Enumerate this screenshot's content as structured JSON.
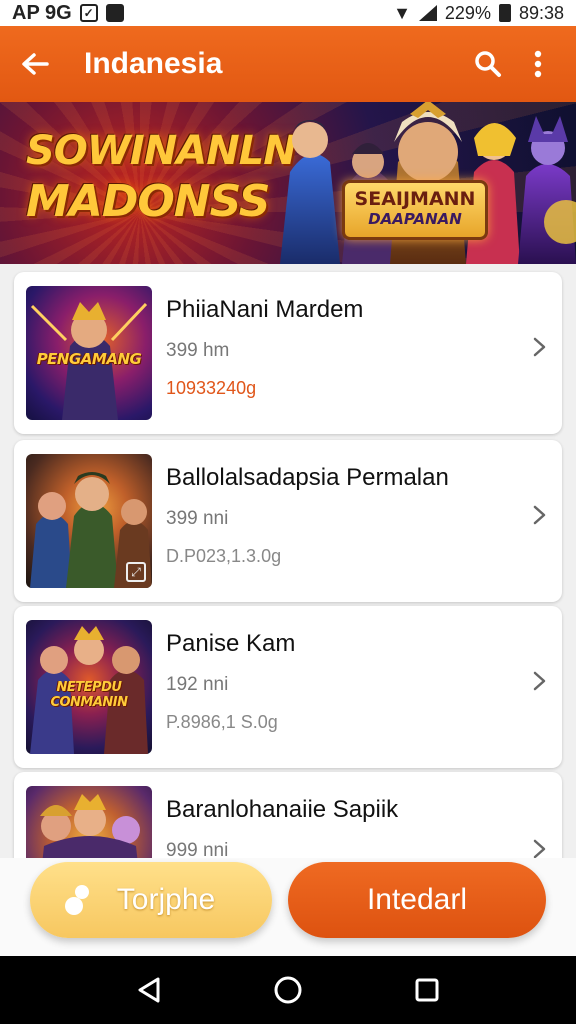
{
  "status_bar": {
    "left_text": "AP 9G",
    "battery": "229%",
    "time": "89:38"
  },
  "app_bar": {
    "title": "Indanesia",
    "back_icon": "arrow-left-icon",
    "search_icon": "search-icon",
    "menu_icon": "more-vert-icon"
  },
  "banner": {
    "logo_line_1": "SOWINANLN",
    "logo_line_2": "MADONSS",
    "sub_logo_line_1": "SEAIJMANN",
    "sub_logo_line_2": "DAAPANAN"
  },
  "items": [
    {
      "name": "PhiiaNani Mardem",
      "meta": "399 hm",
      "size": "10933240g",
      "thumb_label": "PENGAMANG"
    },
    {
      "name": "Ballolalsadapsia Permalan",
      "meta": "399 nni",
      "size": "D.P023,1.3.0g",
      "thumb_label": ""
    },
    {
      "name": "Panise Kam",
      "meta": "192 nni",
      "size": "P.8986,1 S.0g",
      "thumb_label": "NETEPDU CONMANIN"
    },
    {
      "name": "Baranlohanaiie Sapiik",
      "meta": "999 nni",
      "size": "",
      "thumb_label": ""
    }
  ],
  "actions": {
    "secondary_label": "Torjphe",
    "primary_label": "Intedarl"
  },
  "colors": {
    "accent": "#e85d17",
    "secondary_button": "#f7cf6e",
    "size_highlight": "#e0561a"
  },
  "nav": {
    "back_icon": "nav-back-icon",
    "home_icon": "nav-home-icon",
    "recents_icon": "nav-recents-icon"
  }
}
